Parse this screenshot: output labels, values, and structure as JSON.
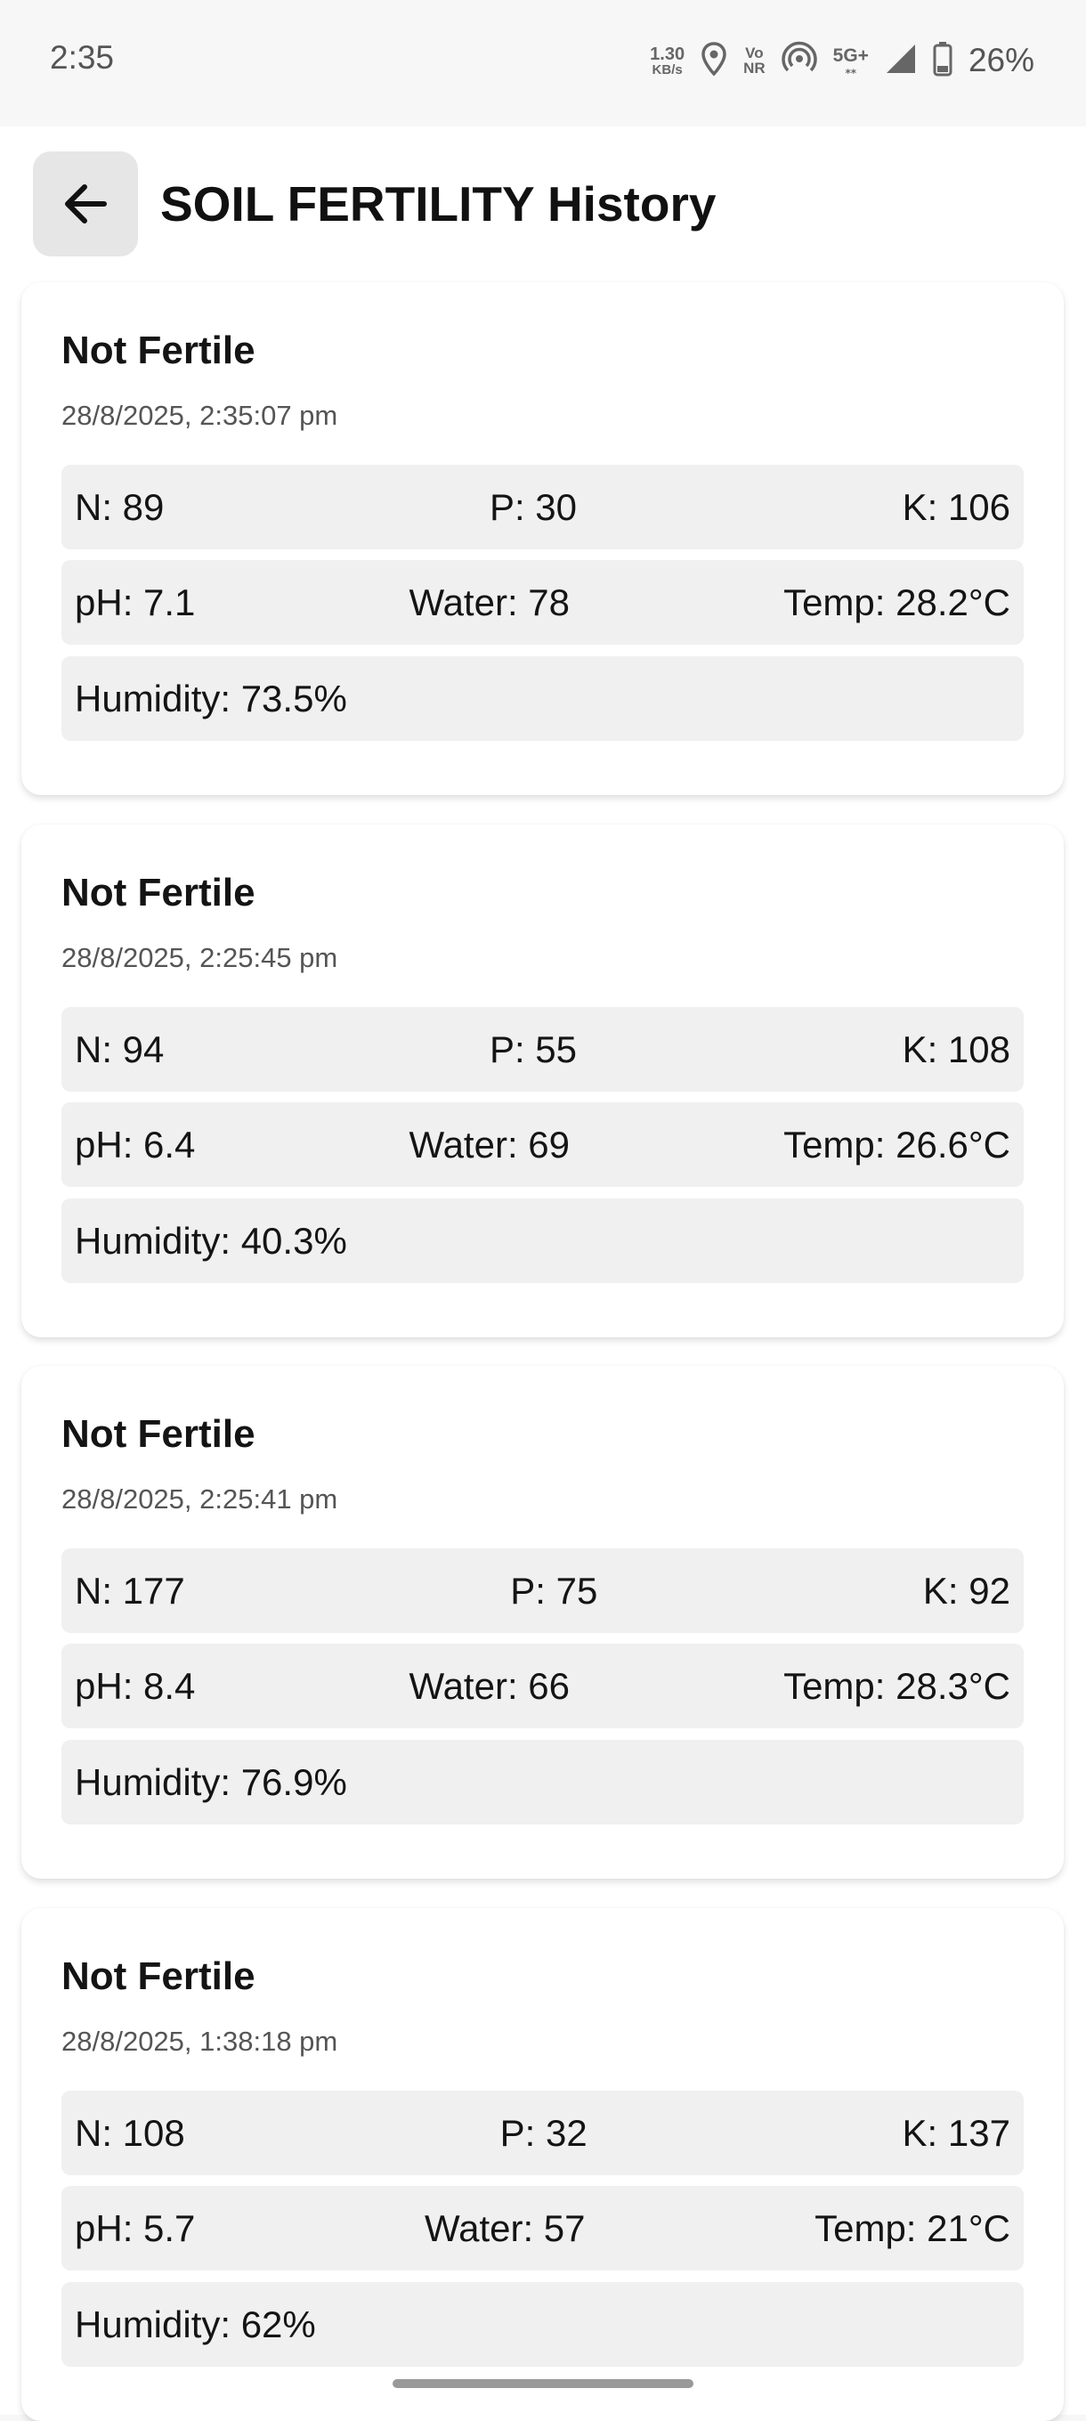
{
  "status_bar": {
    "time": "2:35",
    "net_speed_value": "1.30",
    "net_speed_unit": "KB/s",
    "vonr_top": "Vo",
    "vonr_bottom": "NR",
    "network": "5G+",
    "battery": "26%",
    "icons": [
      "location-icon",
      "hotspot-icon",
      "signal-icon",
      "battery-icon"
    ]
  },
  "header": {
    "back_icon": "arrow-left-icon",
    "title": "SOIL FERTILITY History"
  },
  "records": [
    {
      "status": "Not Fertile",
      "date": "28/8/2025, 2:35:07 pm",
      "n": "N: 89",
      "p": "P: 30",
      "k": "K: 106",
      "ph": "pH: 7.1",
      "water": "Water: 78",
      "temp": "Temp: 28.2°C",
      "humidity": "Humidity: 73.5%"
    },
    {
      "status": "Not Fertile",
      "date": "28/8/2025, 2:25:45 pm",
      "n": "N: 94",
      "p": "P: 55",
      "k": "K: 108",
      "ph": "pH: 6.4",
      "water": "Water: 69",
      "temp": "Temp: 26.6°C",
      "humidity": "Humidity: 40.3%"
    },
    {
      "status": "Not Fertile",
      "date": "28/8/2025, 2:25:41 pm",
      "n": "N: 177",
      "p": "P: 75",
      "k": "K: 92",
      "ph": "pH: 8.4",
      "water": "Water: 66",
      "temp": "Temp: 28.3°C",
      "humidity": "Humidity: 76.9%"
    },
    {
      "status": "Not Fertile",
      "date": "28/8/2025, 1:38:18 pm",
      "n": "N: 108",
      "p": "P: 32",
      "k": "K: 137",
      "ph": "pH: 5.7",
      "water": "Water: 57",
      "temp": "Temp: 21°C",
      "humidity": "Humidity: 62%"
    }
  ]
}
